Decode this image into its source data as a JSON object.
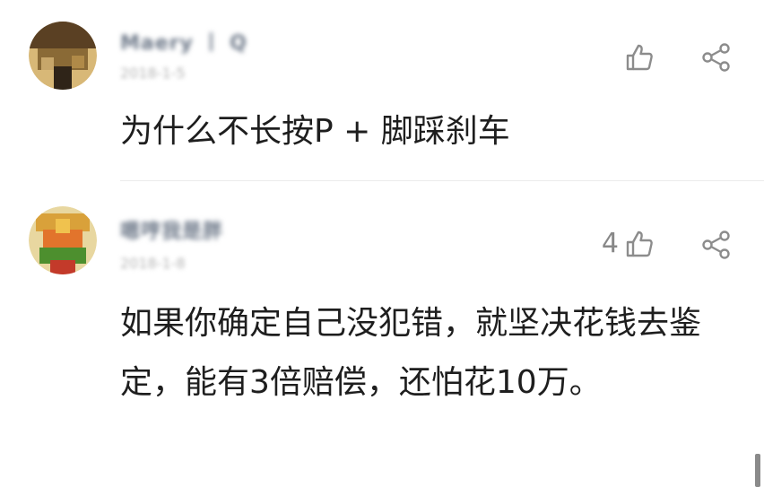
{
  "comments": [
    {
      "author": "Maery 丨 Q",
      "date": "2018-1-5",
      "likes": "",
      "text": "为什么不长按P + 脚踩刹车",
      "avatar_colors": [
        "#3a2d1e",
        "#7a5a2e",
        "#d2b06a"
      ],
      "like_icon": "thumbs-up-icon",
      "share_icon": "share-icon"
    },
    {
      "author": "嗯哼我是胖",
      "date": "2018-1-8",
      "likes": "4",
      "text": "如果你确定自己没犯错，就坚决花钱去鉴定，能有3倍赔偿，还怕花10万。",
      "avatar_colors": [
        "#caa24a",
        "#e06a2a",
        "#3f8f2c"
      ],
      "like_icon": "thumbs-up-icon",
      "share_icon": "share-icon"
    }
  ],
  "colors": {
    "icon_gray": "#8c8c8c",
    "text_dark": "#1e1e1e",
    "name_blur": "#6f7a8a"
  }
}
